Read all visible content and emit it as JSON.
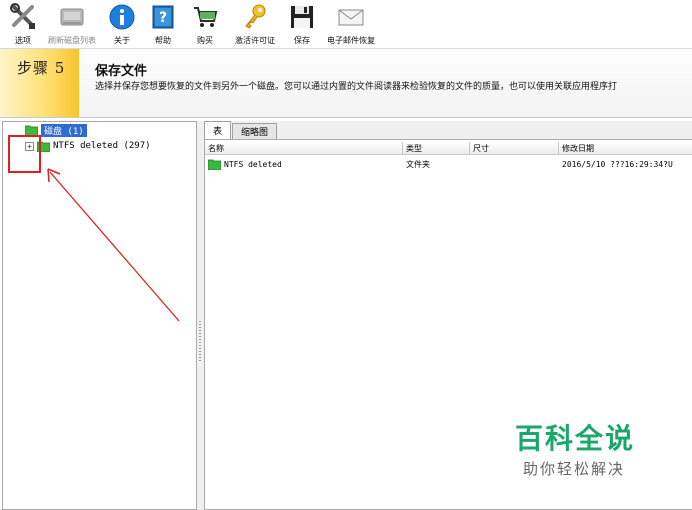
{
  "toolbar": {
    "options": "选项",
    "refresh": "刷新磁盘列表",
    "about": "关于",
    "help": "帮助",
    "buy": "购买",
    "activate": "激活许可证",
    "save": "保存",
    "email_recovery": "电子邮件恢复"
  },
  "banner": {
    "step": "步骤 5",
    "title": "保存文件",
    "description": "选择并保存您想要恢复的文件到另外一个磁盘。您可以通过内置的文件阅读器来检验恢复的文件的质量，也可以使用关联应用程序打"
  },
  "tree": {
    "root_label": "磁盘 (1)",
    "child_label": "NTFS deleted (297)"
  },
  "tabs": {
    "table": "表",
    "thumbnail": "缩略图"
  },
  "columns": {
    "name": "名称",
    "type": "类型",
    "size": "尺寸",
    "modified": "修改日期"
  },
  "rows": [
    {
      "name": "NTFS deleted",
      "type": "文件夹",
      "size": "",
      "modified": "2016/5/10 ???16:29:34?U"
    }
  ],
  "watermark": {
    "main": "百科全说",
    "sub": "助你轻松解决"
  },
  "colors": {
    "accent_red": "#e02020",
    "folder_green": "#3cb83c",
    "selection_blue": "#2e6cd0",
    "watermark_green": "#1aa86a"
  }
}
